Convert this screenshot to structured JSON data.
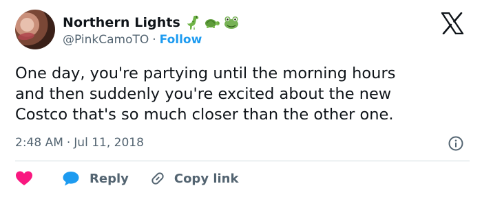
{
  "colors": {
    "accent": "#1d9bf0",
    "text": "#0f1419",
    "muted": "#536471",
    "like": "#f91880",
    "divider": "#cfd9de"
  },
  "author": {
    "display_name": "Northern Lights",
    "emojis": [
      "dinosaur-emoji",
      "turtle-emoji",
      "frog-emoji"
    ],
    "handle": "@PinkCamoTO",
    "separator": "·",
    "follow_label": "Follow"
  },
  "tweet": {
    "lines": [
      "One day, you're partying until the morning hours",
      "and then suddenly you're excited about the new",
      "Costco that's so much closer than the other one."
    ],
    "time": "2:48 AM",
    "separator": "·",
    "date": "Jul 11, 2018"
  },
  "actions": {
    "like_icon": "heart-icon",
    "reply_label": "Reply",
    "copy_label": "Copy link"
  },
  "icons": {
    "brand": "x-logo-icon",
    "info": "info-icon"
  }
}
